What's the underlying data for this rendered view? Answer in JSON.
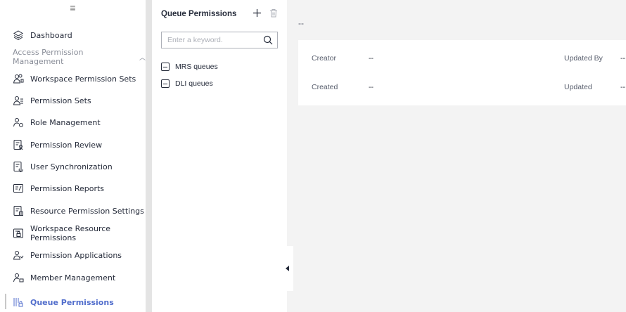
{
  "sidebar": {
    "toggle_glyph": "≡",
    "items": [
      {
        "label": "Dashboard",
        "icon": "layers-icon"
      },
      {
        "label": "Access Permission Management",
        "icon": "",
        "group": true
      },
      {
        "label": "Workspace Permission Sets",
        "icon": "users-lock-icon"
      },
      {
        "label": "Permission Sets",
        "icon": "user-list-icon"
      },
      {
        "label": "Role Management",
        "icon": "user-gear-icon"
      },
      {
        "label": "Permission Review",
        "icon": "doc-user-icon"
      },
      {
        "label": "User Synchronization",
        "icon": "doc-sync-icon"
      },
      {
        "label": "Permission Reports",
        "icon": "report-icon"
      },
      {
        "label": "Resource Permission Settings",
        "icon": "doc-settings-icon"
      },
      {
        "label": "Workspace Resource Permissions",
        "icon": "workspace-lock-icon"
      },
      {
        "label": "Permission Applications",
        "icon": "user-apply-icon"
      },
      {
        "label": "Member Management",
        "icon": "member-icon"
      },
      {
        "label": "Queue Permissions",
        "icon": "queue-lock-icon",
        "active": true
      }
    ]
  },
  "tree_panel": {
    "title": "Queue Permissions",
    "search_placeholder": "Enter a keyword.",
    "nodes": [
      "MRS queues",
      "DLI queues"
    ]
  },
  "detail": {
    "title": "--",
    "fields": {
      "creator_label": "Creator",
      "creator_value": "--",
      "updated_by_label": "Updated By",
      "updated_by_value": "--",
      "created_label": "Created",
      "created_value": "--",
      "updated_label": "Updated",
      "updated_value": "--"
    }
  },
  "colors": {
    "accent": "#526ecc",
    "background": "#f3f3f3",
    "panel": "#ffffff",
    "divider": "#e4e4e4"
  }
}
